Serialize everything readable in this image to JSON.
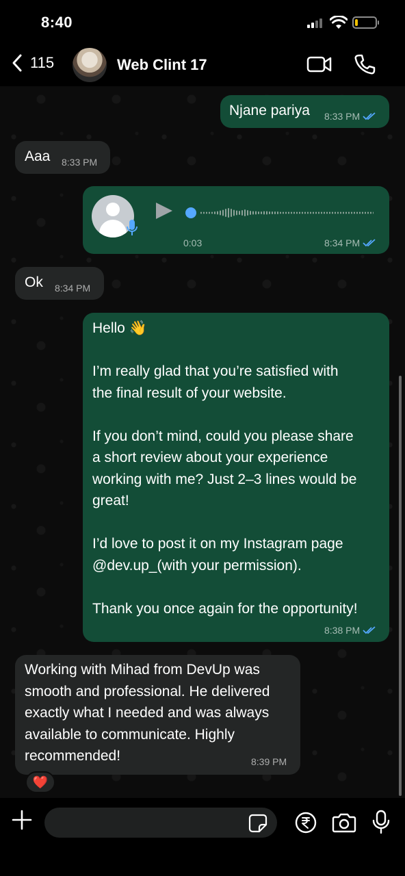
{
  "status_bar": {
    "time": "8:40",
    "battery_level": 0.15,
    "battery_color": "#f2c200"
  },
  "header": {
    "back_count": "115",
    "contact_name": "Web Clint 17",
    "icons": [
      "chevron-left-icon",
      "video-call-icon",
      "phone-icon"
    ]
  },
  "messages": [
    {
      "direction": "out",
      "text": "Njane pariya",
      "time": "8:33 PM",
      "read": true
    },
    {
      "direction": "in",
      "text": "Aaa",
      "time": "8:33 PM"
    },
    {
      "direction": "out",
      "type": "voice",
      "duration": "0:03",
      "time": "8:34 PM",
      "read": true,
      "progress": 0
    },
    {
      "direction": "in",
      "text": "Ok",
      "time": "8:34 PM"
    },
    {
      "direction": "out",
      "text": "Hello 👋\n\nI’m really glad that you’re satisfied with\nthe final result of your website.\n\nIf you don’t mind, could you please share\na short review about your experience\nworking with me? Just 2–3 lines would be\ngreat!\n\nI’d love to post it on my Instagram page\n@dev.up_(with your permission).\n\nThank you once again for the opportunity!",
      "time": "8:38 PM",
      "read": true
    },
    {
      "direction": "in",
      "text": "Working with Mihad from DevUp was\nsmooth and professional. He delivered\nexactly what I needed and was always\navailable to communicate. Highly\nrecommended!",
      "time": "8:39 PM",
      "reaction": "❤️"
    }
  ],
  "input": {
    "value": "",
    "placeholder": ""
  },
  "colors": {
    "outgoing_bubble": "#134d37",
    "incoming_bubble": "#242626",
    "read_ticks": "#55a8ff",
    "background": "#0c0c0c"
  }
}
